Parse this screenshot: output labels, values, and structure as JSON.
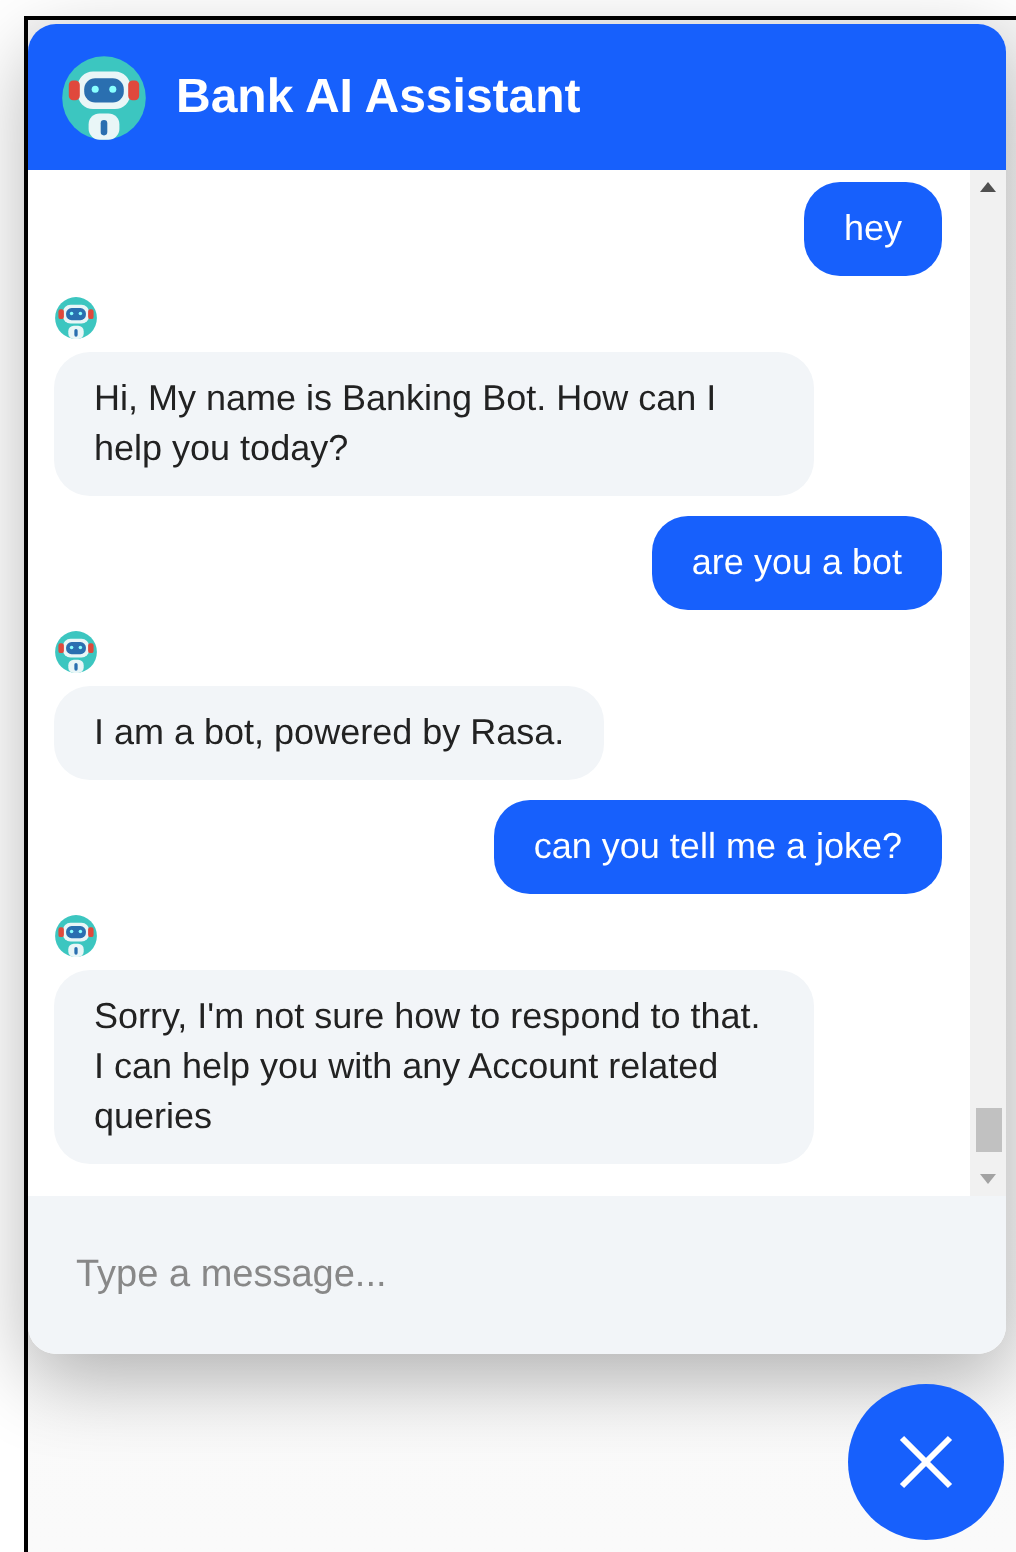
{
  "header": {
    "title": "Bank AI Assistant"
  },
  "messages": [
    {
      "kind": "user",
      "text": "hey"
    },
    {
      "kind": "bot",
      "text": "Hi, My name is Banking Bot. How can I help you today?"
    },
    {
      "kind": "user",
      "text": "are you a bot"
    },
    {
      "kind": "bot",
      "text": "I am a bot, powered by Rasa."
    },
    {
      "kind": "user",
      "text": "can you tell me a joke?"
    },
    {
      "kind": "bot",
      "text": "Sorry, I'm not sure how to respond to that. I can help you with any Account related queries"
    }
  ],
  "composer": {
    "placeholder": "Type a message..."
  }
}
